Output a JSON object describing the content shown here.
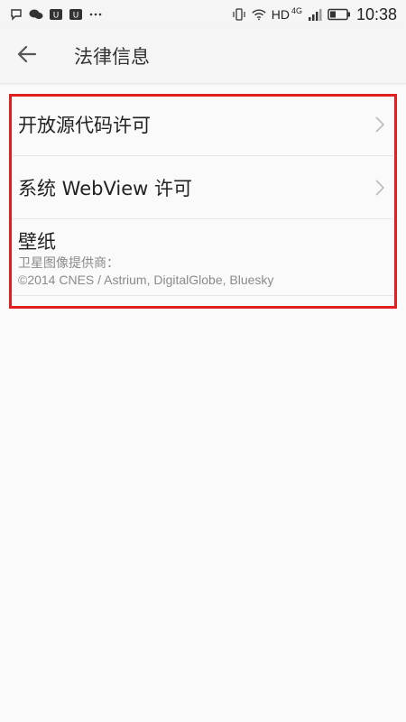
{
  "status_bar": {
    "network_label": "HD",
    "network_type": "4G",
    "time": "10:38",
    "icons": [
      "chat-bubble-icon",
      "wechat-icon",
      "app-badge-icon",
      "app-badge-icon",
      "more-dots-icon",
      "vibrate-icon",
      "wifi-icon",
      "signal-icon",
      "battery-icon"
    ]
  },
  "app_bar": {
    "title": "法律信息",
    "back_icon": "arrow-left-icon"
  },
  "list": {
    "items": [
      {
        "label": "开放源代码许可",
        "type": "nav"
      },
      {
        "label": "系统 WebView 许可",
        "type": "nav"
      },
      {
        "label": "壁纸",
        "type": "info",
        "subtitle_1": "卫星图像提供商：",
        "subtitle_2": "©2014 CNES / Astrium, DigitalGlobe, Bluesky"
      }
    ]
  },
  "colors": {
    "highlight": "#e02020",
    "background": "#fafafa",
    "secondary_text": "#8a8a8a"
  }
}
